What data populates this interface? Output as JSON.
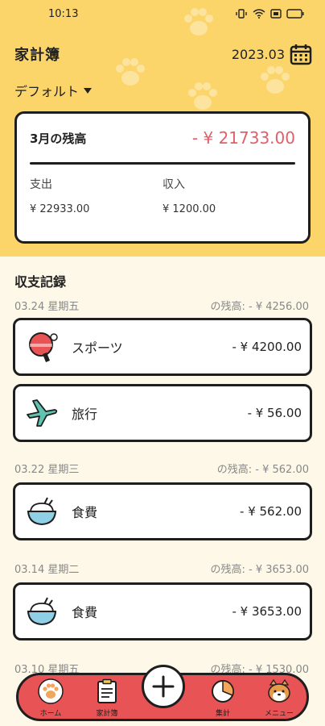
{
  "status_bar": {
    "time": "10:13"
  },
  "header": {
    "title": "家計簿",
    "month": "2023.03"
  },
  "book_selector": {
    "label": "デフォルト"
  },
  "balance_card": {
    "label": "3月の残高",
    "balance": "- ¥ 21733.00",
    "expense_label": "支出",
    "expense_value": "¥ 22933.00",
    "income_label": "収入",
    "income_value": "¥ 1200.00"
  },
  "records": {
    "title": "収支記録",
    "days": [
      {
        "date": "03.24 星期五",
        "balance": "の残高: - ¥ 4256.00",
        "items": [
          {
            "name": "スポーツ",
            "amount": "- ¥ 4200.00",
            "icon": "ping-pong-icon"
          },
          {
            "name": "旅行",
            "amount": "- ¥ 56.00",
            "icon": "airplane-icon"
          }
        ]
      },
      {
        "date": "03.22 星期三",
        "balance": "の残高: - ¥ 562.00",
        "items": [
          {
            "name": "食費",
            "amount": "- ¥ 562.00",
            "icon": "rice-bowl-icon"
          }
        ]
      },
      {
        "date": "03.14 星期二",
        "balance": "の残高: - ¥ 3653.00",
        "items": [
          {
            "name": "食費",
            "amount": "- ¥ 3653.00",
            "icon": "rice-bowl-icon"
          }
        ]
      },
      {
        "date": "03.10 星期五",
        "balance": "の残高: - ¥ 1530.00",
        "items": []
      }
    ]
  },
  "bottom_nav": {
    "home": "ホーム",
    "ledger": "家計簿",
    "stats": "集計",
    "menu": "メニュー"
  },
  "colors": {
    "header_yellow": "#fbd46a",
    "background_cream": "#fdf8e8",
    "negative_red": "#e0606a",
    "nav_red": "#e85455"
  }
}
